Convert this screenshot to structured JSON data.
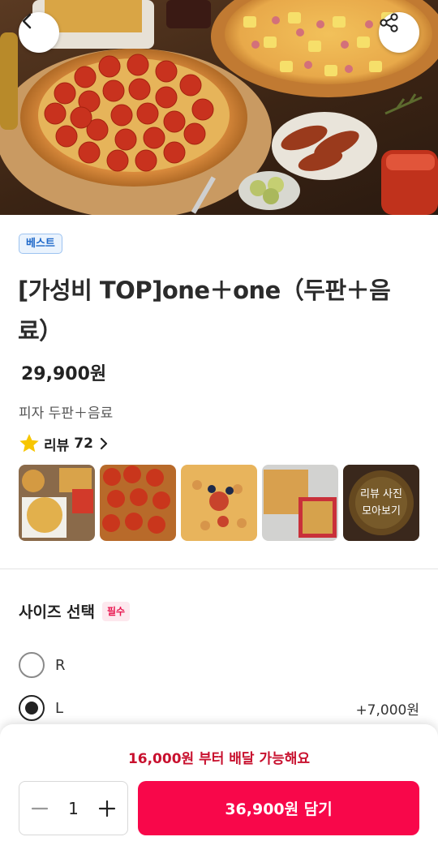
{
  "header": {
    "back_icon": "chevron-left-icon",
    "share_icon": "share-icon"
  },
  "product": {
    "badge": "베스트",
    "title": "[가성비 TOP]one＋one（두판＋음료）",
    "price": "29,900원",
    "description": "피자 두판＋음료"
  },
  "reviews": {
    "label": "리뷰",
    "count": "72",
    "star_color": "#f7c600",
    "more_photos_line1": "리뷰 사진",
    "more_photos_line2": "모아보기"
  },
  "size_section": {
    "title": "사이즈 선택",
    "required_label": "필수",
    "options": [
      {
        "name": "R",
        "price": "",
        "selected": false
      },
      {
        "name": "L",
        "price": "+7,000원",
        "selected": true
      }
    ]
  },
  "cart": {
    "min_order_notice": "16,000원 부터 배달 가능해요",
    "quantity": "1",
    "add_button_label": "36,900원 담기",
    "accent_color": "#f8074a"
  }
}
